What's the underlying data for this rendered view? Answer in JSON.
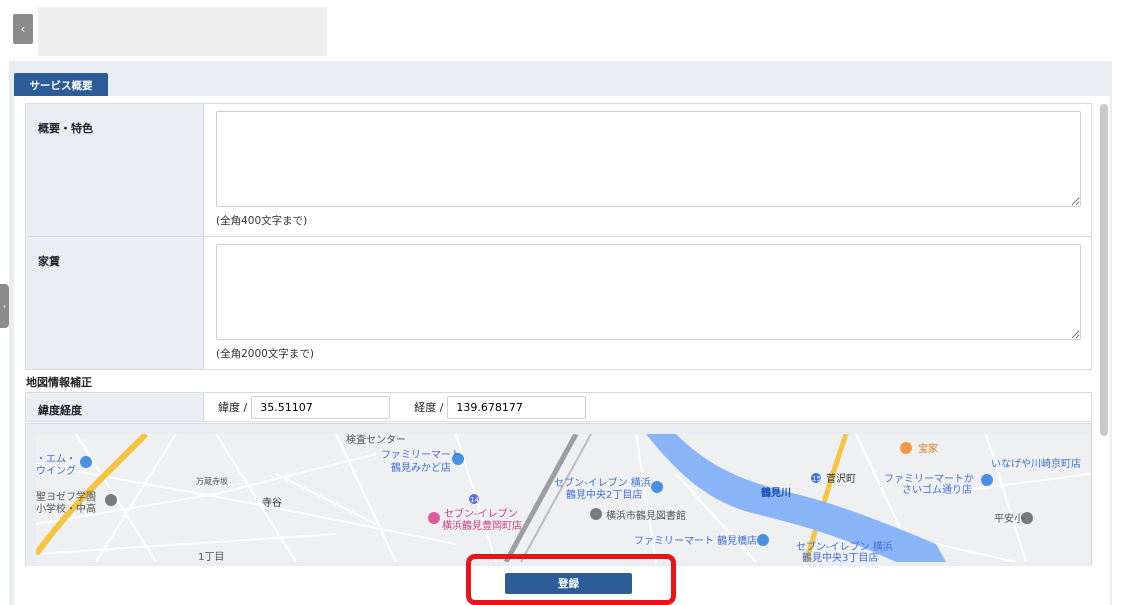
{
  "header": {
    "back_icon": "chevron-left-icon",
    "back_glyph": "‹"
  },
  "tab": {
    "label": "サービス概要"
  },
  "form": {
    "rows": [
      {
        "label": "概要・特色",
        "value": "",
        "hint": "(全角400文字まで)"
      },
      {
        "label": "家賃",
        "value": "",
        "hint": "(全角2000文字まで)"
      }
    ]
  },
  "map_section": {
    "title": "地図情報補正",
    "row_label": "緯度経度",
    "lat_label": "緯度 /",
    "lat_value": "35.51107",
    "lng_label": "経度 /",
    "lng_value": "139.678177"
  },
  "map": {
    "labels": {
      "kensa": "検査センター",
      "fm_mikado_1": "ファミリーマート",
      "fm_mikado_2": "鶴見みかど店",
      "emu_1": "・エム・",
      "emu_2": "ウイング",
      "seiyo_1": "聖ヨゼフ学園",
      "seiyo_2": "小学校・中高",
      "teraya": "寺谷",
      "banzo": "万蔵寺坂",
      "chome1": "1丁目",
      "se_toyooka_1": "セブン-イレブン",
      "se_toyooka_2": "横浜鶴見豊岡町店",
      "se_chuo2_1": "セブン-イレブン 横浜",
      "se_chuo2_2": "鶴見中央2丁目店",
      "library": "横浜市鶴見図書館",
      "fm_tsurumibashi": "ファミリーマート 鶴見橋店",
      "se_chuo3_1": "セブン-イレブン 横浜",
      "se_chuo3_2": "鶴見中央3丁目店",
      "river": "鶴見川",
      "sugasawa": "菅沢町",
      "fm_saigomu_1": "ファミリーマートか",
      "fm_saigomu_2": "さいゴム通り店",
      "takaraya": "宝家",
      "inageya": "いなげや川崎京町店",
      "heian": "平安小",
      "route15": "15",
      "route14": "14"
    }
  },
  "actions": {
    "submit_label": "登録"
  },
  "colors": {
    "primary": "#2c5d96",
    "highlight": "#e8141a",
    "panel": "#e9eef5",
    "river": "#8ab4f8"
  }
}
